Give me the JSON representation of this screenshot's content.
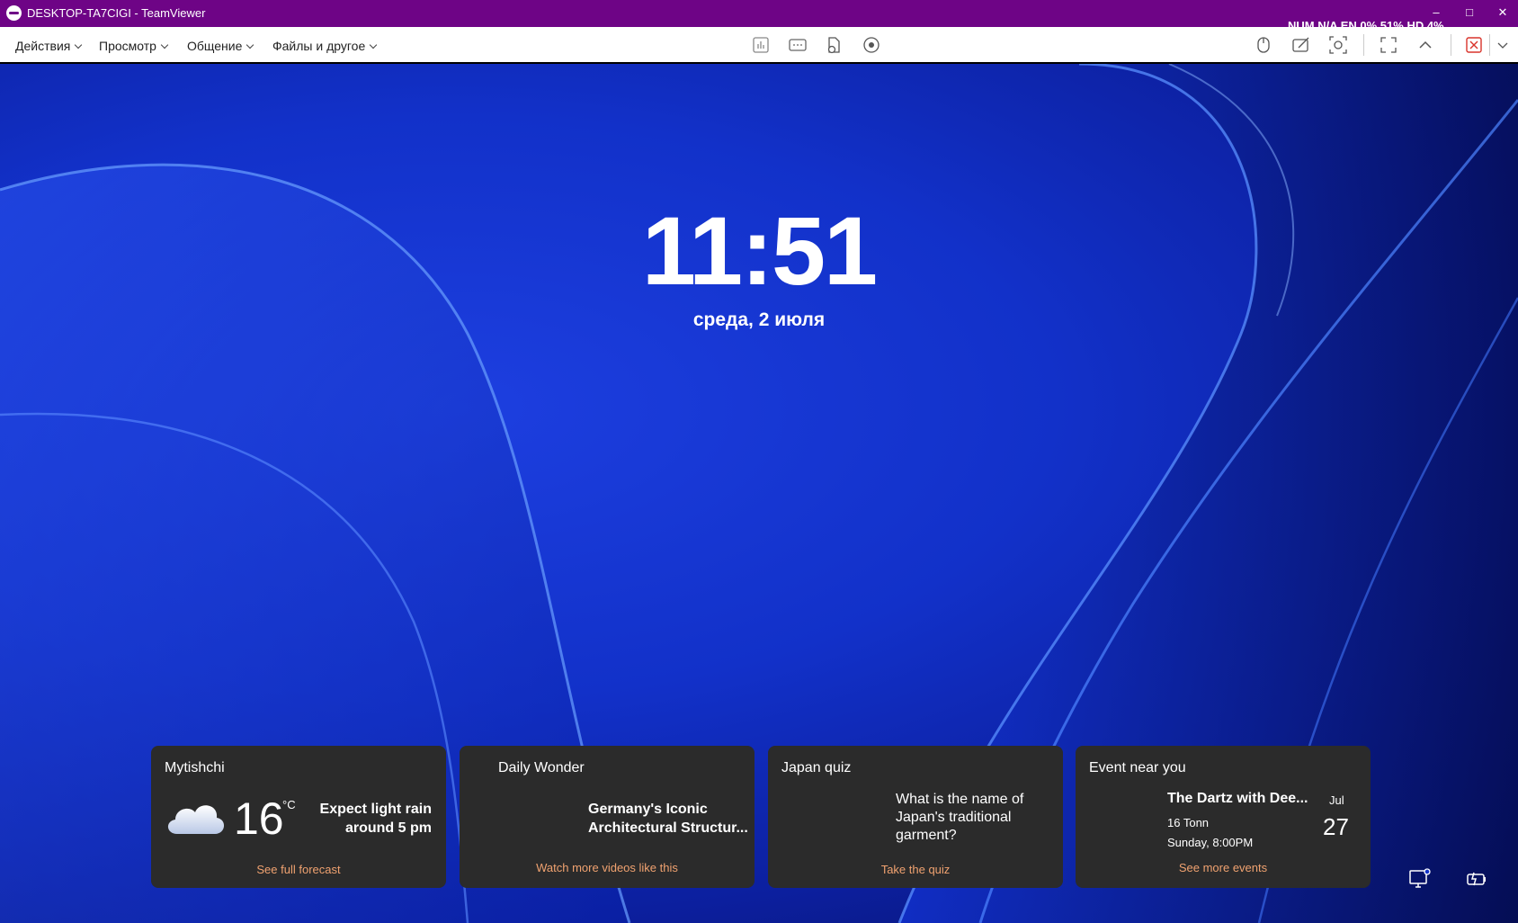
{
  "window": {
    "title": "DESKTOP-TA7CIGI - TeamViewer",
    "status_text": "NUM N/A EN 0% 51% HD 4%"
  },
  "toolbar": {
    "menus": [
      "Действия",
      "Просмотр",
      "Общение",
      "Файлы и другое"
    ]
  },
  "lockscreen": {
    "time": "11:51",
    "date": "среда, 2 июля"
  },
  "widgets": {
    "weather": {
      "title": "Mytishchi",
      "temperature": "16",
      "unit": "°C",
      "desc_line1": "Expect light rain",
      "desc_line2": "around 5 pm",
      "link": "See full forecast"
    },
    "wonder": {
      "title": "Daily Wonder",
      "line1": "Germany's Iconic",
      "line2": "Architectural Structur...",
      "link": "Watch more videos like this"
    },
    "quiz": {
      "title": "Japan quiz",
      "question": "What is the name of Japan's traditional garment?",
      "link": "Take the quiz"
    },
    "event": {
      "title": "Event near you",
      "name": "The Dartz with Dee...",
      "venue": "16 Tonn",
      "time": "Sunday, 8:00PM",
      "month": "Jul",
      "day": "27",
      "link": "See more events"
    }
  },
  "colors": {
    "titlebar": "#6e0486",
    "card_bg": "#2b2b2b",
    "link": "#f0a270",
    "close_accent": "#d9342b"
  }
}
